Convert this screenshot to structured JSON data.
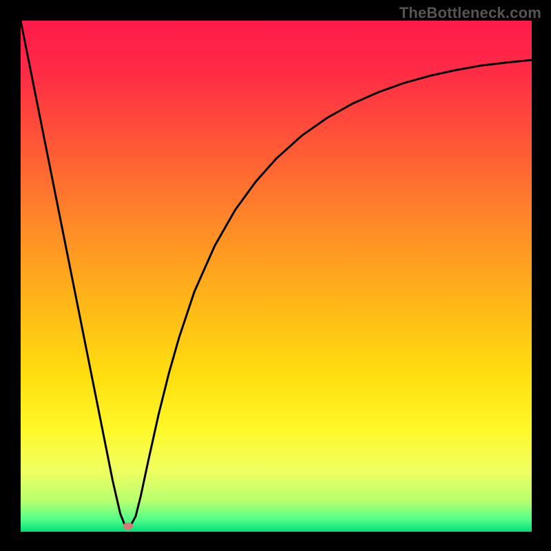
{
  "watermark": "TheBottleneck.com",
  "chart_data": {
    "type": "line",
    "title": "",
    "xlabel": "",
    "ylabel": "",
    "xlim": [
      0,
      100
    ],
    "ylim": [
      0,
      100
    ],
    "grid": false,
    "gradient_stops": [
      {
        "offset": 0.0,
        "color": "#ff1a4a"
      },
      {
        "offset": 0.1,
        "color": "#ff2b45"
      },
      {
        "offset": 0.25,
        "color": "#ff5a36"
      },
      {
        "offset": 0.4,
        "color": "#ff8a28"
      },
      {
        "offset": 0.55,
        "color": "#ffb618"
      },
      {
        "offset": 0.7,
        "color": "#ffe010"
      },
      {
        "offset": 0.8,
        "color": "#fff82a"
      },
      {
        "offset": 0.88,
        "color": "#f0ff60"
      },
      {
        "offset": 0.94,
        "color": "#b8ff70"
      },
      {
        "offset": 0.975,
        "color": "#55ff88"
      },
      {
        "offset": 1.0,
        "color": "#00e07a"
      }
    ],
    "curve": {
      "x": [
        0,
        2,
        4,
        6,
        8,
        10,
        12,
        14,
        16,
        18,
        19.5,
        20.5,
        21.5,
        22.5,
        23.5,
        25,
        27,
        29,
        31,
        34,
        38,
        42,
        46,
        50,
        55,
        60,
        65,
        70,
        75,
        80,
        85,
        90,
        95,
        100
      ],
      "y": [
        100,
        90,
        80,
        70,
        60,
        50,
        40,
        30,
        20,
        10,
        3.5,
        1.0,
        1.2,
        3.0,
        7.0,
        14,
        23,
        31,
        38,
        47,
        56,
        63,
        68.5,
        73,
        77.5,
        81,
        83.8,
        86,
        87.8,
        89.2,
        90.3,
        91.2,
        91.8,
        92.3
      ]
    },
    "marker": {
      "x": 21.0,
      "y": 1.1,
      "rx": 1.0,
      "ry": 0.7,
      "color": "#d47b7a"
    },
    "line_color": "#000000",
    "line_width": 3
  }
}
